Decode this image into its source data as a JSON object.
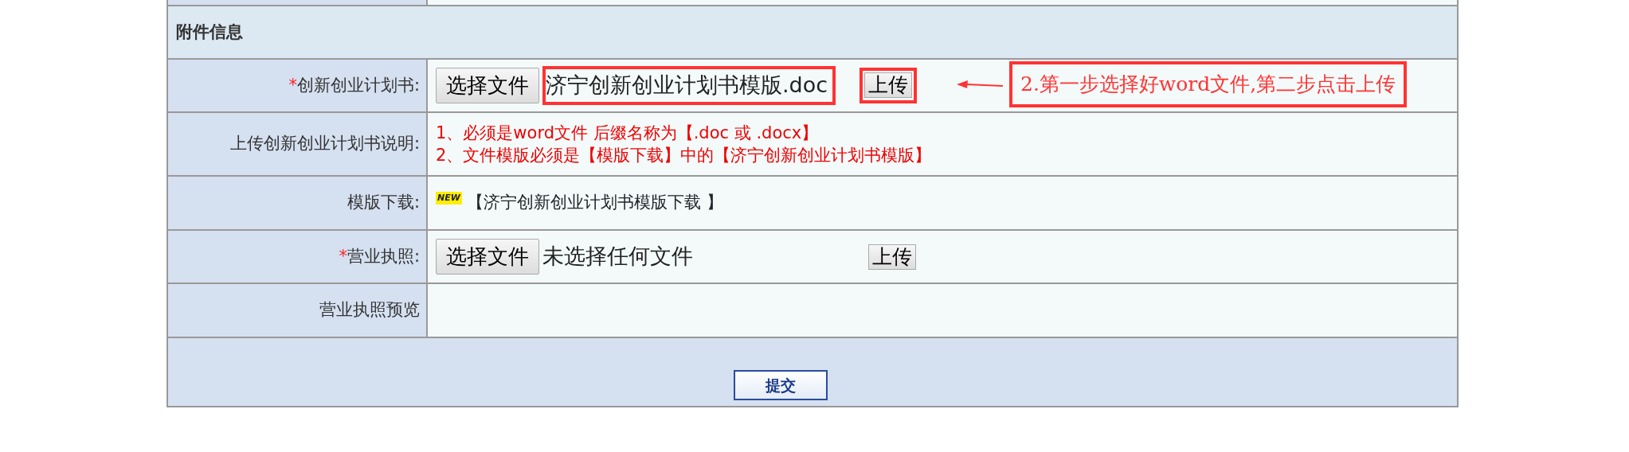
{
  "section_title": "附件信息",
  "rows": [
    {
      "kind": "file",
      "label": "创新创业计划书:",
      "required": true,
      "required_mark": "*",
      "choose_button": "选择文件",
      "file_name": "济宁创新创业计划书模版.doc",
      "upload_button": "上传",
      "highlighted": true
    },
    {
      "kind": "note",
      "label": "上传创新创业计划书说明:",
      "lines": [
        "1、必须是word文件 后缀名称为【.doc 或 .docx】",
        "2、文件模版必须是【模版下载】中的【济宁创新创业计划书模版】"
      ]
    },
    {
      "kind": "download",
      "label": "模版下载:",
      "badge": "NEW",
      "link": "【济宁创新创业计划书模版下载 】"
    },
    {
      "kind": "file",
      "label": "营业执照:",
      "required": true,
      "required_mark": "*",
      "choose_button": "选择文件",
      "file_name": "未选择任何文件",
      "upload_button": "上传",
      "highlighted": false
    },
    {
      "kind": "preview",
      "label": "营业执照预览"
    }
  ],
  "annotation": "2.第一步选择好word文件,第二步点击上传",
  "submit_button": "提交"
}
